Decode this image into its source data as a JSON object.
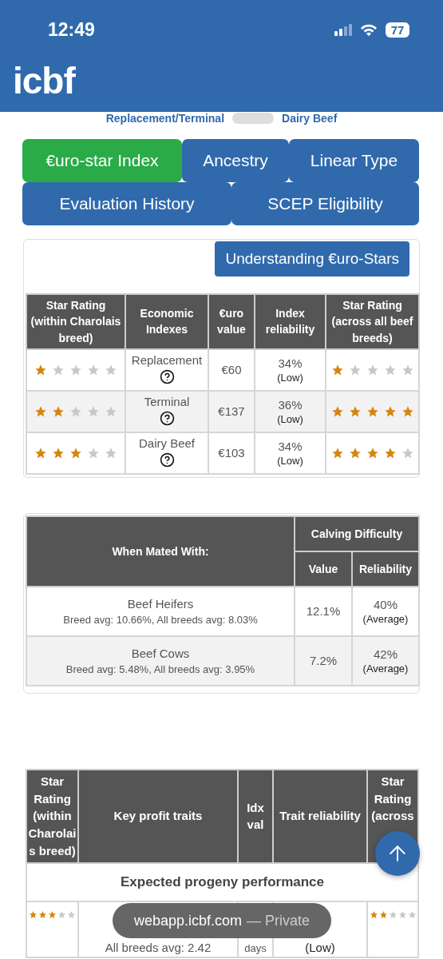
{
  "status_bar": {
    "time": "12:49",
    "battery": "77"
  },
  "header": {
    "logo": "icbf"
  },
  "index_toggle": {
    "left_label": "Replacement/Terminal",
    "right_label": "Dairy Beef",
    "on": false
  },
  "tabs": [
    {
      "label": "€uro-star Index",
      "selected": true
    },
    {
      "label": "Ancestry",
      "selected": false
    },
    {
      "label": "Linear Type",
      "selected": false
    },
    {
      "label": "Evaluation History",
      "selected": false
    },
    {
      "label": "SCEP Eligibility",
      "selected": false
    }
  ],
  "understanding_button": "Understanding €uro-Stars",
  "index_table": {
    "columns": [
      "Star Rating (within Charolais breed)",
      "Economic Indexes",
      "€uro value",
      "Index reliability",
      "Star Rating (across all beef breeds)"
    ],
    "rows": [
      {
        "breed_rating": {
          "stars": 1
        },
        "index": "Replacement",
        "euro_value": "€60",
        "reliability": "34%",
        "reliability_level": "(Low)",
        "all_breeds_rating": {
          "stars": 1
        }
      },
      {
        "breed_rating": {
          "stars": 2
        },
        "index": "Terminal",
        "euro_value": "€137",
        "reliability": "36%",
        "reliability_level": "(Low)",
        "all_breeds_rating": {
          "stars": 5
        }
      },
      {
        "breed_rating": {
          "stars": 3
        },
        "index": "Dairy Beef",
        "euro_value": "€103",
        "reliability": "34%",
        "reliability_level": "(Low)",
        "all_breeds_rating": {
          "stars": 4
        }
      }
    ]
  },
  "calving_table": {
    "group_column": "When Mated With:",
    "group_header": "Calving Difficulty",
    "columns": [
      "Value",
      "Reliability"
    ],
    "rows": [
      {
        "name": "Beef Heifers",
        "averages": "Breed avg: 10.66%, All breeds avg: 8.03%",
        "value": "12.1%",
        "reliability": "40%",
        "reliability_level": "(Average)"
      },
      {
        "name": "Beef Cows",
        "averages": "Breed avg: 5.48%, All breeds avg: 3.95%",
        "value": "7.2%",
        "reliability": "42%",
        "reliability_level": "(Average)"
      }
    ]
  },
  "traits_table": {
    "columns": [
      "Star Rating (within Charolais breed)",
      "Key profit traits",
      "Idx val",
      "Trait reliability",
      "Star Rating (across"
    ],
    "section": "Expected progeny performance",
    "rows": [
      {
        "breed_rating": {
          "stars": 3
        },
        "trait_averages": "All breeds avg: 2.42",
        "idx_val": "days",
        "reliability_level": "(Low)",
        "all_breeds_rating": {
          "stars": 2
        }
      }
    ]
  },
  "url_pill": {
    "domain": "webapp.icbf.com",
    "mode": "— Private"
  }
}
